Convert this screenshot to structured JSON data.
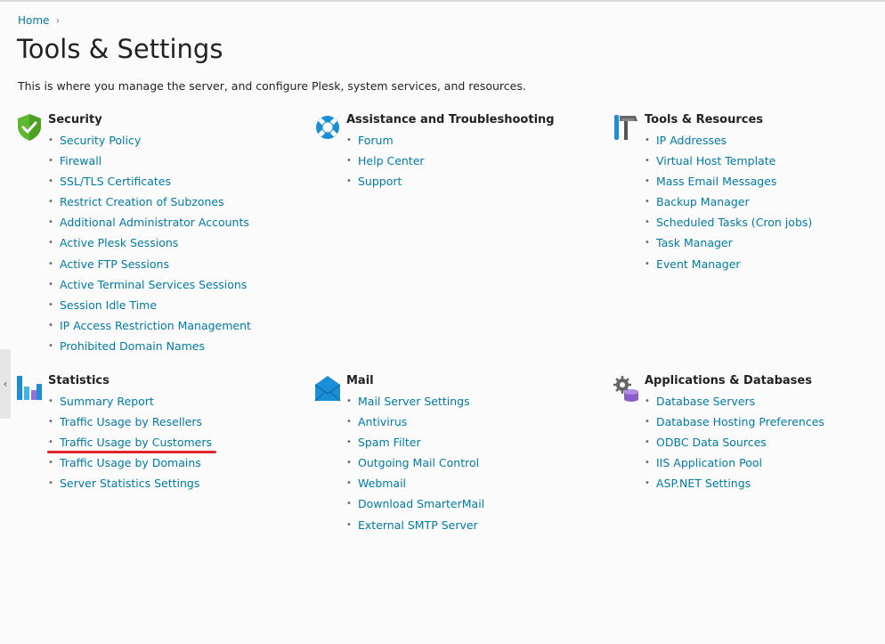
{
  "breadcrumb": {
    "home": "Home",
    "separator": "›"
  },
  "page": {
    "title": "Tools & Settings",
    "description": "This is where you manage the server, and configure Plesk, system services, and resources."
  },
  "groups": {
    "security": {
      "title": "Security",
      "icon": "shield-check-icon",
      "items": [
        "Security Policy",
        "Firewall",
        "SSL/TLS Certificates",
        "Restrict Creation of Subzones",
        "Additional Administrator Accounts",
        "Active Plesk Sessions",
        "Active FTP Sessions",
        "Active Terminal Services Sessions",
        "Session Idle Time",
        "IP Access Restriction Management",
        "Prohibited Domain Names"
      ]
    },
    "assistance": {
      "title": "Assistance and Troubleshooting",
      "icon": "lifebuoy-icon",
      "items": [
        "Forum",
        "Help Center",
        "Support"
      ]
    },
    "tools": {
      "title": "Tools & Resources",
      "icon": "tools-icon",
      "items": [
        "IP Addresses",
        "Virtual Host Template",
        "Mass Email Messages",
        "Backup Manager",
        "Scheduled Tasks (Cron jobs)",
        "Task Manager",
        "Event Manager"
      ]
    },
    "statistics": {
      "title": "Statistics",
      "icon": "bar-chart-icon",
      "items": [
        "Summary Report",
        "Traffic Usage by Resellers",
        "Traffic Usage by Customers",
        "Traffic Usage by Domains",
        "Server Statistics Settings"
      ]
    },
    "mail": {
      "title": "Mail",
      "icon": "envelope-icon",
      "items": [
        "Mail Server Settings",
        "Antivirus",
        "Spam Filter",
        "Outgoing Mail Control",
        "Webmail",
        "Download SmarterMail",
        "External SMTP Server"
      ]
    },
    "apps": {
      "title": "Applications & Databases",
      "icon": "gear-database-icon",
      "items": [
        "Database Servers",
        "Database Hosting Preferences",
        "ODBC Data Sources",
        "IIS Application Pool",
        "ASP.NET Settings"
      ]
    }
  },
  "colors": {
    "link": "#007aa3",
    "annotation": "#e0252e"
  }
}
